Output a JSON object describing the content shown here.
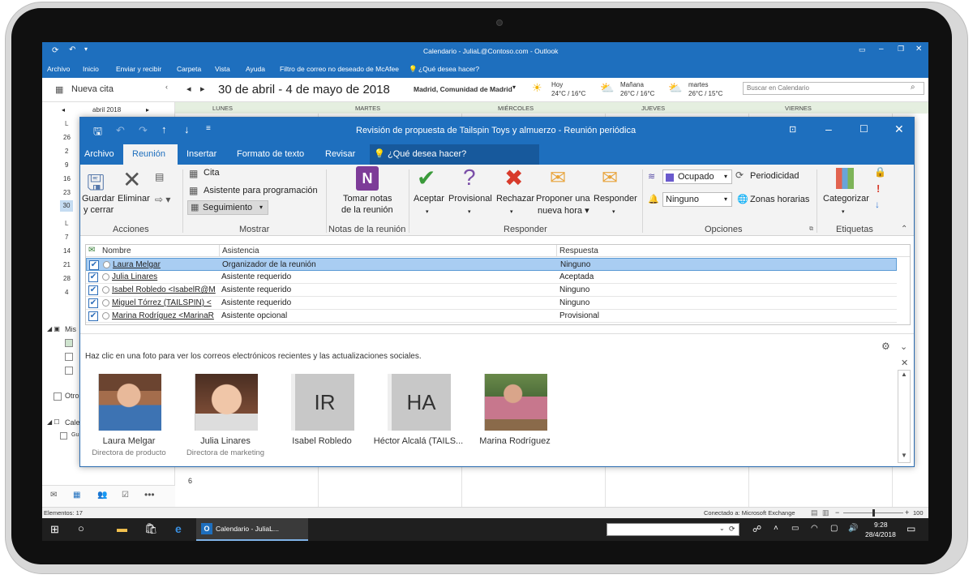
{
  "window": {
    "title": "Calendario - JuliaL@Contoso.com - Outlook"
  },
  "main_menu": [
    "Archivo",
    "Inicio",
    "Enviar y recibir",
    "Carpeta",
    "Vista",
    "Ayuda",
    "Filtro de correo no deseado de McAfee",
    "¿Qué desea hacer?"
  ],
  "calendar": {
    "new_appointment": "Nueva cita",
    "date_range": "30 de abril - 4 de mayo de 2018",
    "location": "Madrid, Comunidad de Madrid",
    "weather": [
      {
        "day": "Hoy",
        "temp": "24°C / 16°C"
      },
      {
        "day": "Mañana",
        "temp": "26°C / 16°C"
      },
      {
        "day": "martes",
        "temp": "26°C / 15°C"
      }
    ],
    "search_placeholder": "Buscar en Calendario",
    "weekdays": [
      "LUNES",
      "MARTES",
      "MIÉRCOLES",
      "JUEVES",
      "VIERNES"
    ],
    "mini_month": "abril 2018",
    "mini_letter": "L",
    "mini_days": [
      "26",
      "2",
      "9",
      "16",
      "23",
      "30"
    ],
    "mini_days_may": [
      "7",
      "14",
      "21",
      "28",
      "4"
    ],
    "folder_mis": "Mis",
    "folder_otro": "Otro",
    "folder_cale": "Cale",
    "folder_gu": "Gu",
    "grid_day": "6"
  },
  "status": {
    "items": "Elementos: 17",
    "connection": "Conectado a: Microsoft Exchange",
    "zoom": "100 %"
  },
  "taskbar": {
    "app_label": "Calendario - JuliaL...",
    "time": "9:28",
    "date": "28/4/2018"
  },
  "dialog": {
    "title": "Revisión de propuesta de Tailspin Toys y almuerzo - Reunión periódica",
    "tabs": [
      "Archivo",
      "Reunión",
      "Insertar",
      "Formato de texto",
      "Revisar"
    ],
    "tell_me": "¿Qué desea hacer?",
    "ribbon": {
      "save_close": "Guardar y cerrar",
      "delete": "Eliminar",
      "acciones": "Acciones",
      "cita": "Cita",
      "asistente": "Asistente para programación",
      "seguimiento": "Seguimiento",
      "mostrar": "Mostrar",
      "tomar_notas": "Tomar notas de la reunión",
      "notas_group": "Notas de la reunión",
      "aceptar": "Aceptar",
      "provisional": "Provisional",
      "rechazar": "Rechazar",
      "proponer": "Proponer una nueva hora",
      "responder": "Responder",
      "responder_group": "Responder",
      "ocupado": "Ocupado",
      "ninguno": "Ninguno",
      "periodicidad": "Periodicidad",
      "zonas": "Zonas horarias",
      "opciones": "Opciones",
      "categorizar": "Categorizar",
      "etiquetas": "Etiquetas"
    },
    "table": {
      "headers": [
        "Nombre",
        "Asistencia",
        "Respuesta"
      ],
      "rows": [
        {
          "name": "Laura Melgar",
          "attendance": "Organizador de la reunión",
          "response": "Ninguno"
        },
        {
          "name": "Julia Linares",
          "attendance": "Asistente requerido",
          "response": "Aceptada"
        },
        {
          "name": "Isabel Robledo <IsabelR@M",
          "attendance": "Asistente requerido",
          "response": "Ninguno"
        },
        {
          "name": "Miguel Tórrez (TAILSPIN) <",
          "attendance": "Asistente requerido",
          "response": "Ninguno"
        },
        {
          "name": "Marina Rodríguez <MarinaR",
          "attendance": "Asistente opcional",
          "response": "Provisional"
        }
      ]
    },
    "people_hint": "Haz clic en una foto para ver los correos electrónicos recientes y las actualizaciones sociales.",
    "people": [
      {
        "name": "Laura Melgar",
        "role": "Directora de producto"
      },
      {
        "name": "Julia Linares",
        "role": "Directora de marketing"
      },
      {
        "name": "Isabel Robledo",
        "role": "",
        "initials": "IR"
      },
      {
        "name": "Héctor Alcalá (TAILS...",
        "role": "",
        "initials": "HA"
      },
      {
        "name": "Marina Rodríguez",
        "role": ""
      }
    ]
  }
}
